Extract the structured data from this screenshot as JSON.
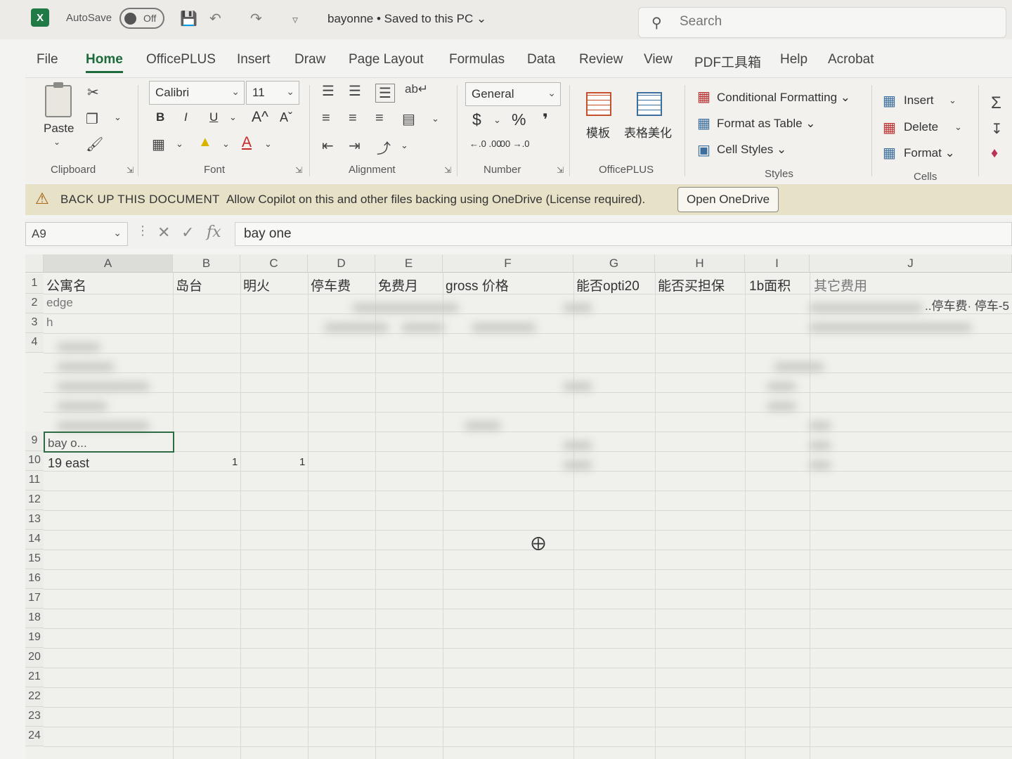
{
  "titlebar": {
    "autosave_label": "AutoSave",
    "autosave_state": "Off",
    "doc_title": "bayonne • Saved to this PC ⌄",
    "search_placeholder": "Search"
  },
  "tabs": [
    "File",
    "Home",
    "OfficePLUS",
    "Insert",
    "Draw",
    "Page Layout",
    "Formulas",
    "Data",
    "Review",
    "View",
    "PDF工具箱",
    "Help",
    "Acrobat"
  ],
  "active_tab": "Home",
  "ribbon": {
    "clipboard": {
      "label": "Clipboard",
      "paste": "Paste"
    },
    "font": {
      "label": "Font",
      "font_name": "Calibri",
      "font_size": "11",
      "bold": "B",
      "italic": "I",
      "underline": "U",
      "grow": "A^",
      "shrink": "Aˇ"
    },
    "alignment": {
      "label": "Alignment"
    },
    "number": {
      "label": "Number",
      "format": "General",
      "currency": "$",
      "percent": "%",
      "comma": "❜",
      "inc_decimal": "←.0 .00",
      "dec_decimal": ".00 →.0"
    },
    "officeplus": {
      "label": "OfficePLUS",
      "template": "模板",
      "beautify": "表格美化"
    },
    "styles": {
      "label": "Styles",
      "conditional": "Conditional Formatting ⌄",
      "format_table": "Format as Table ⌄",
      "cell_styles": "Cell Styles ⌄"
    },
    "cells": {
      "label": "Cells",
      "insert": "Insert",
      "delete": "Delete",
      "format": "Format ⌄"
    }
  },
  "infobar": {
    "title": "BACK UP THIS DOCUMENT",
    "message": "Allow Copilot on this and other files backing using OneDrive (License required).",
    "button": "Open OneDrive"
  },
  "formulabar": {
    "namebox": "A9",
    "fx": "fx",
    "content": "bay one"
  },
  "columns": [
    "A",
    "B",
    "C",
    "D",
    "E",
    "F",
    "G",
    "H",
    "I",
    "J"
  ],
  "headers": [
    "公寓名",
    "岛台",
    "明火",
    "停车费",
    "免费月",
    "gross 价格",
    "能否opti20",
    "能否买担保",
    "1b面积",
    "其它费用"
  ],
  "rows": [
    "1",
    "2",
    "3",
    "4",
    "9",
    "10",
    "11",
    "12",
    "13",
    "14",
    "15",
    "16",
    "17",
    "18",
    "19",
    "20",
    "21",
    "22",
    "23",
    "24"
  ],
  "cells": {
    "a2": "edge",
    "a3": "h",
    "a9": "bay o...",
    "a10": "19 east",
    "b10": "1",
    "c10": "1",
    "j2": "..停车费· 停车-5"
  }
}
